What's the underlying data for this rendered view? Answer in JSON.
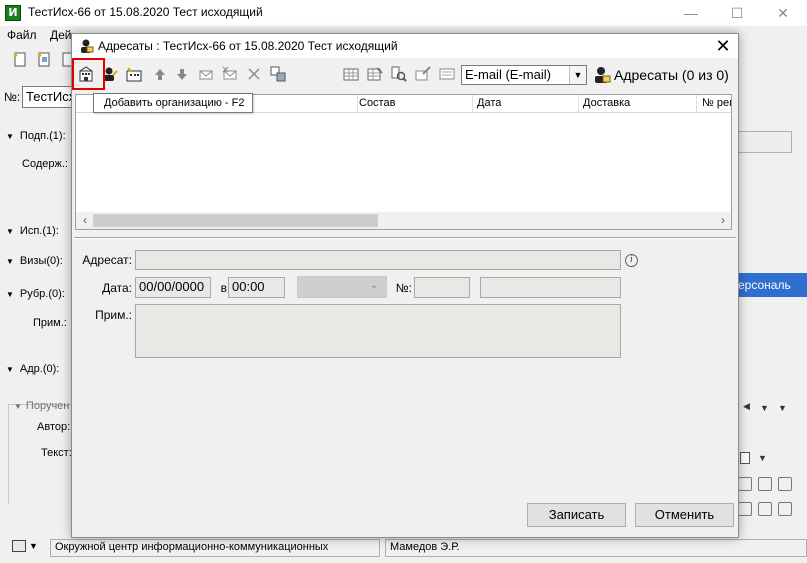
{
  "background_window": {
    "title": "ТестИсх-66 от 15.08.2020 Тест исходящий",
    "app_icon_letter": "И",
    "menu": [
      "Файл",
      "Дей"
    ],
    "number_label": "№:",
    "number_value": "ТестИсх",
    "sections": [
      "Подп.(1):",
      "Исп.(1):",
      "Визы(0):",
      "Рубр.(0):",
      "Адр.(0):"
    ],
    "labels": {
      "content": "Содерж.:",
      "note": "Прим.:",
      "assignment": "Поручен",
      "author": "Автор:",
      "text": "Текст:"
    },
    "right_blue_text": "ерсональ",
    "status_org": "Окружной центр информационно-коммуникационных",
    "status_user": "Мамедов Э.Р."
  },
  "dialog": {
    "title": "Адресаты : ТестИсх-66 от 15.08.2020 Тест исходящий",
    "close_glyph": "✕",
    "delivery_select": "E-mail (E-mail)",
    "addressees_count": "Адресаты (0 из 0)",
    "tooltip": "Добавить организацию - F2",
    "grid_columns": [
      "Состав",
      "Дата",
      "Доставка",
      "№ рег"
    ],
    "form": {
      "addressee_label": "Адресат:",
      "date_label": "Дата:",
      "date_value": "00/00/0000",
      "at_label": "в",
      "time_value": "00:00",
      "number_label": "№:",
      "note_label": "Прим.:"
    },
    "buttons": {
      "save": "Записать",
      "cancel": "Отменить"
    }
  },
  "colors": {
    "highlight": "#e00000",
    "selection_blue": "#2f6fd0"
  },
  "icons": {
    "add_org": "add-organization-icon",
    "add_person": "add-person-icon",
    "add_group": "add-group-icon",
    "move_up": "arrow-up-icon",
    "move_down": "arrow-down-icon",
    "delete": "delete-icon",
    "info": "info-icon"
  }
}
